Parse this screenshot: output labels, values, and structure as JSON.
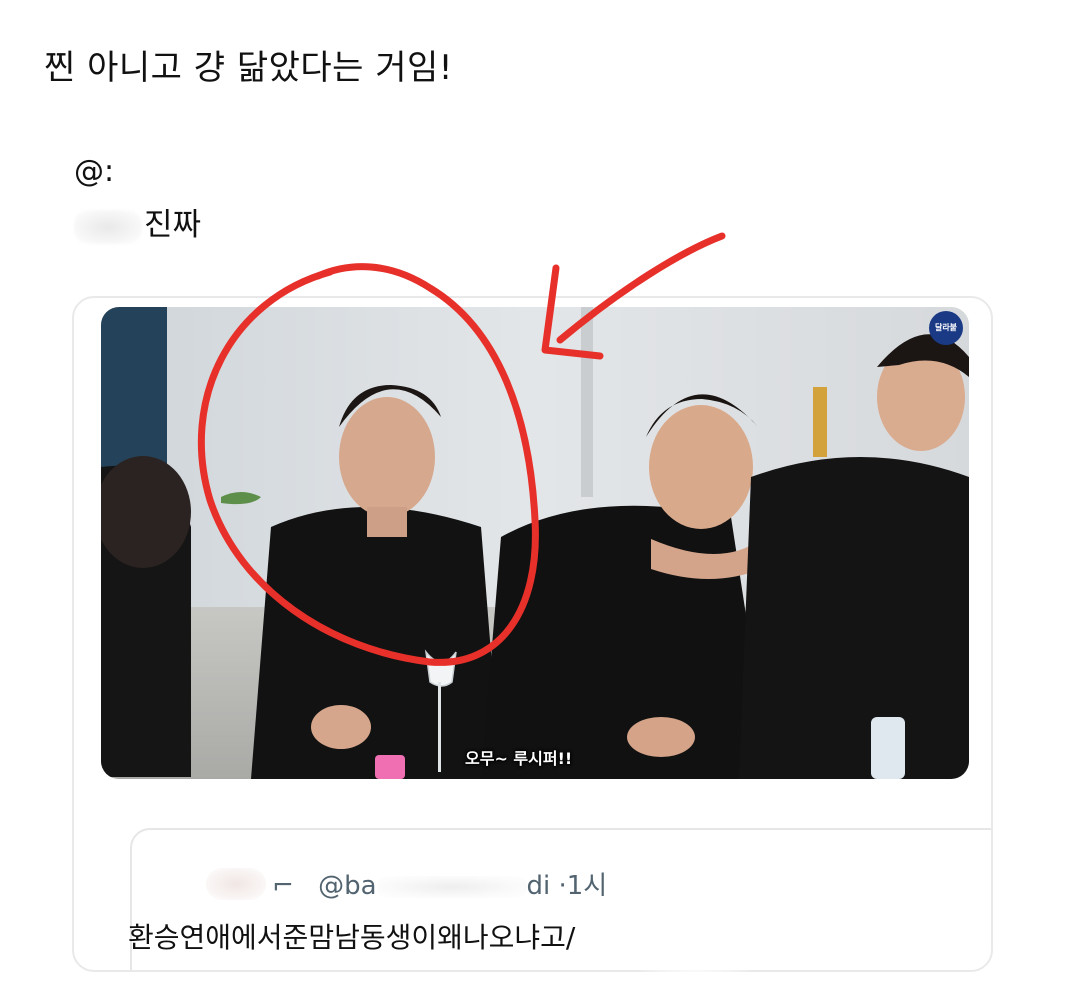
{
  "post": {
    "text": "찐 아니고 걍 닮았다는 거임!"
  },
  "quoted_tweet": {
    "author": "@:",
    "text": "진짜",
    "media": {
      "subtitle_text": "오무~ 루시퍼!!",
      "channel_badge_text": "달라붙"
    },
    "nested_quote": {
      "header_left": "⌐",
      "handle": "@ba",
      "handle_end": "di",
      "separator": "·",
      "time": "1시",
      "text": "환승연애에서준맘남동생이왜나오냐고/"
    }
  },
  "colors": {
    "annotation_red": "#e8302a",
    "text_primary": "#111111",
    "text_secondary": "#536471",
    "card_border": "#e9e9e9"
  }
}
